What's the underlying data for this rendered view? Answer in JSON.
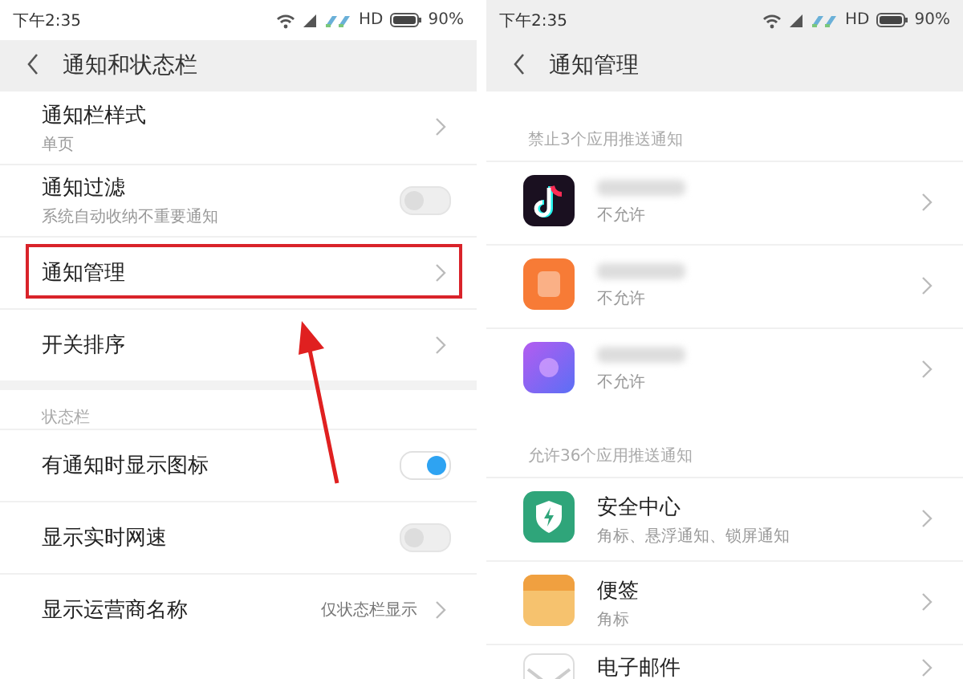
{
  "screens": [
    {
      "status_bar": {
        "time": "下午2:35",
        "network": "HD",
        "battery": "90%"
      },
      "header": {
        "title": "通知和状态栏"
      },
      "sections": [
        {
          "rows": [
            {
              "kind": "link",
              "title": "通知栏样式",
              "subtitle": "单页",
              "highlighted": false
            },
            {
              "kind": "toggle",
              "title": "通知过滤",
              "subtitle": "系统自动收纳不重要通知",
              "on": false,
              "highlighted": false
            },
            {
              "kind": "link",
              "title": "通知管理",
              "highlighted": true
            },
            {
              "kind": "link",
              "title": "开关排序",
              "highlighted": false
            }
          ]
        },
        {
          "label": "状态栏",
          "rows": [
            {
              "kind": "toggle",
              "title": "有通知时显示图标",
              "on": true,
              "highlighted": false
            },
            {
              "kind": "toggle",
              "title": "显示实时网速",
              "on": false,
              "highlighted": false
            },
            {
              "kind": "link",
              "title": "显示运营商名称",
              "value": "仅状态栏显示",
              "highlighted": false
            }
          ]
        }
      ]
    },
    {
      "status_bar": {
        "time": "下午2:35",
        "network": "HD",
        "battery": "90%"
      },
      "header": {
        "title": "通知管理"
      },
      "sections": [
        {
          "label": "禁止3个应用推送通知",
          "rows": [
            {
              "kind": "app",
              "subtitle": "不允许",
              "highlighted": false
            },
            {
              "kind": "app",
              "subtitle": "不允许",
              "highlighted": false
            },
            {
              "kind": "app",
              "subtitle": "不允许",
              "highlighted": false
            }
          ]
        },
        {
          "label": "允许36个应用推送通知",
          "rows": [
            {
              "kind": "app",
              "title": "安全中心",
              "subtitle": "角标、悬浮通知、锁屏通知",
              "highlighted": false
            },
            {
              "kind": "app",
              "title": "便签",
              "subtitle": "角标",
              "highlighted": false
            },
            {
              "kind": "app",
              "title": "电子邮件",
              "highlighted": false
            }
          ]
        }
      ]
    }
  ]
}
